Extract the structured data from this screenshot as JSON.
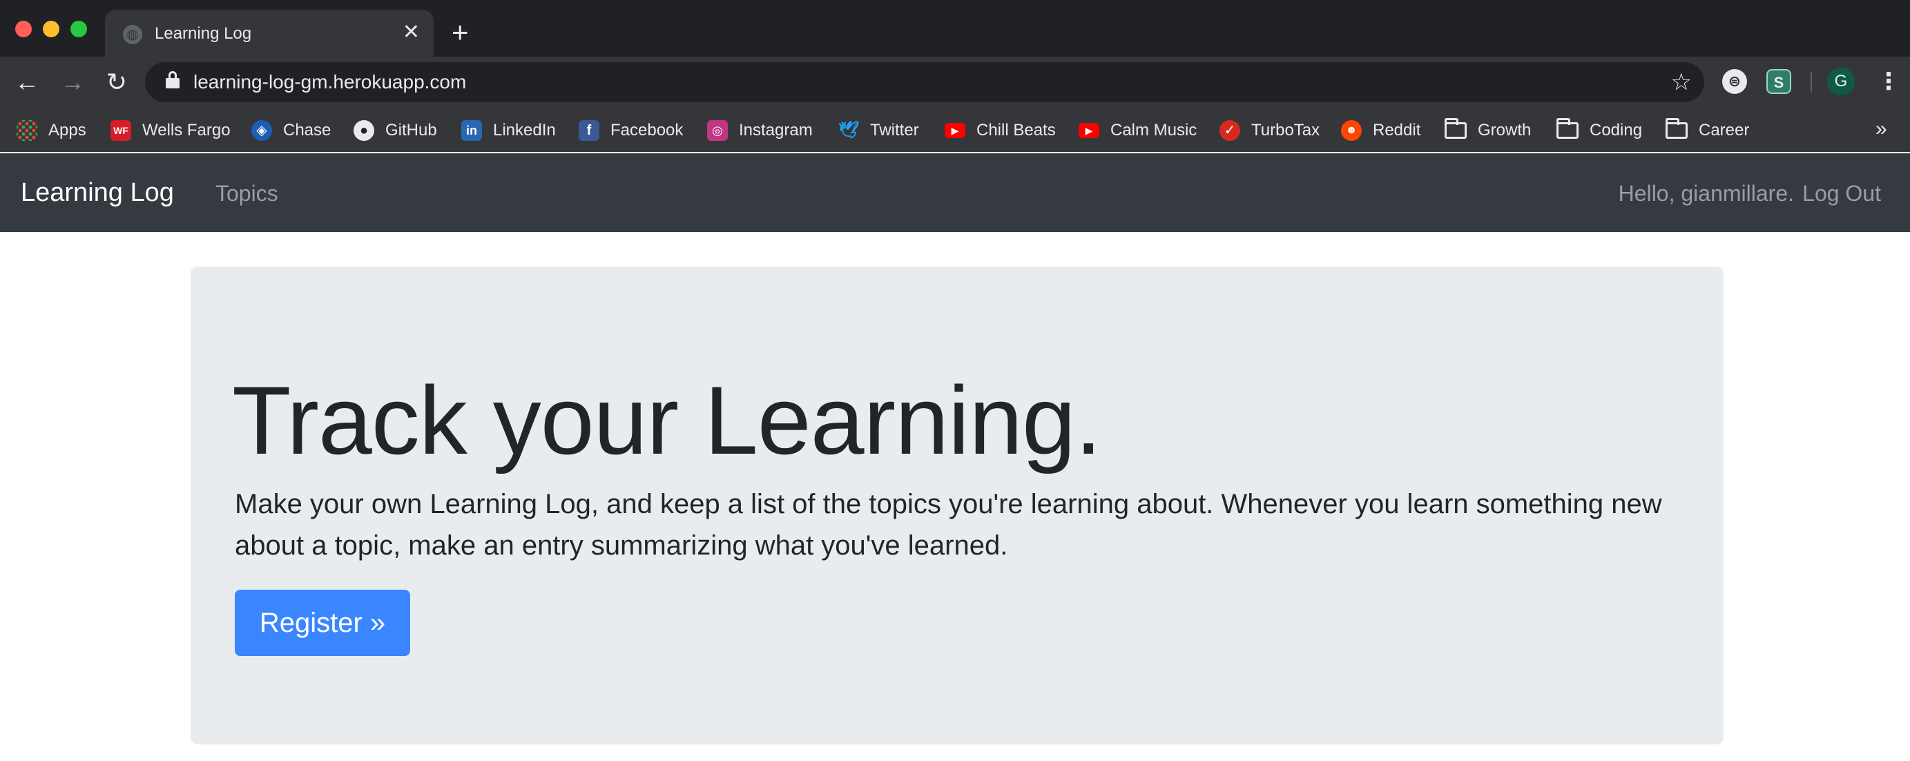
{
  "browser": {
    "tab": {
      "title": "Learning Log",
      "favicon": "globe-icon",
      "close_glyph": "✕"
    },
    "new_tab_glyph": "+",
    "address_bar": {
      "url": "learning-log-gm.herokuapp.com"
    },
    "profile_initial": "G",
    "bookmarks": [
      {
        "label": "Apps",
        "icon": "apps-grid-icon"
      },
      {
        "label": "Wells Fargo",
        "icon": "wells-fargo-icon",
        "color": "#d71e28"
      },
      {
        "label": "Chase",
        "icon": "chase-icon",
        "color": "#1a5fb4"
      },
      {
        "label": "GitHub",
        "icon": "github-icon",
        "color": "#e8eaed"
      },
      {
        "label": "LinkedIn",
        "icon": "linkedin-icon",
        "color": "#2867b2"
      },
      {
        "label": "Facebook",
        "icon": "facebook-icon",
        "color": "#3b5998"
      },
      {
        "label": "Instagram",
        "icon": "instagram-icon",
        "color": "#c13584"
      },
      {
        "label": "Twitter",
        "icon": "twitter-icon",
        "color": "#1da1f2"
      },
      {
        "label": "Chill Beats",
        "icon": "youtube-icon",
        "color": "#ff0000"
      },
      {
        "label": "Calm Music",
        "icon": "youtube-icon",
        "color": "#ff0000"
      },
      {
        "label": "TurboTax",
        "icon": "turbotax-icon",
        "color": "#d52b1e"
      },
      {
        "label": "Reddit",
        "icon": "reddit-icon",
        "color": "#ff4500"
      },
      {
        "label": "Growth",
        "icon": "folder-icon"
      },
      {
        "label": "Coding",
        "icon": "folder-icon"
      },
      {
        "label": "Career",
        "icon": "folder-icon"
      }
    ],
    "bookmarks_overflow": "»"
  },
  "navbar": {
    "brand": "Learning Log",
    "topics_link": "Topics",
    "greeting": "Hello, gianmillare.",
    "logout_link": "Log Out"
  },
  "hero": {
    "heading": "Track your Learning.",
    "lead": "Make your own Learning Log, and keep a list of the topics you're learning about. Whenever you learn something new about a topic, make an entry summarizing what you've learned.",
    "register_label": "Register »"
  },
  "colors": {
    "navbar_bg": "#343a40",
    "jumbotron_bg": "#e9ecef",
    "primary_button": "#3a86ff"
  }
}
